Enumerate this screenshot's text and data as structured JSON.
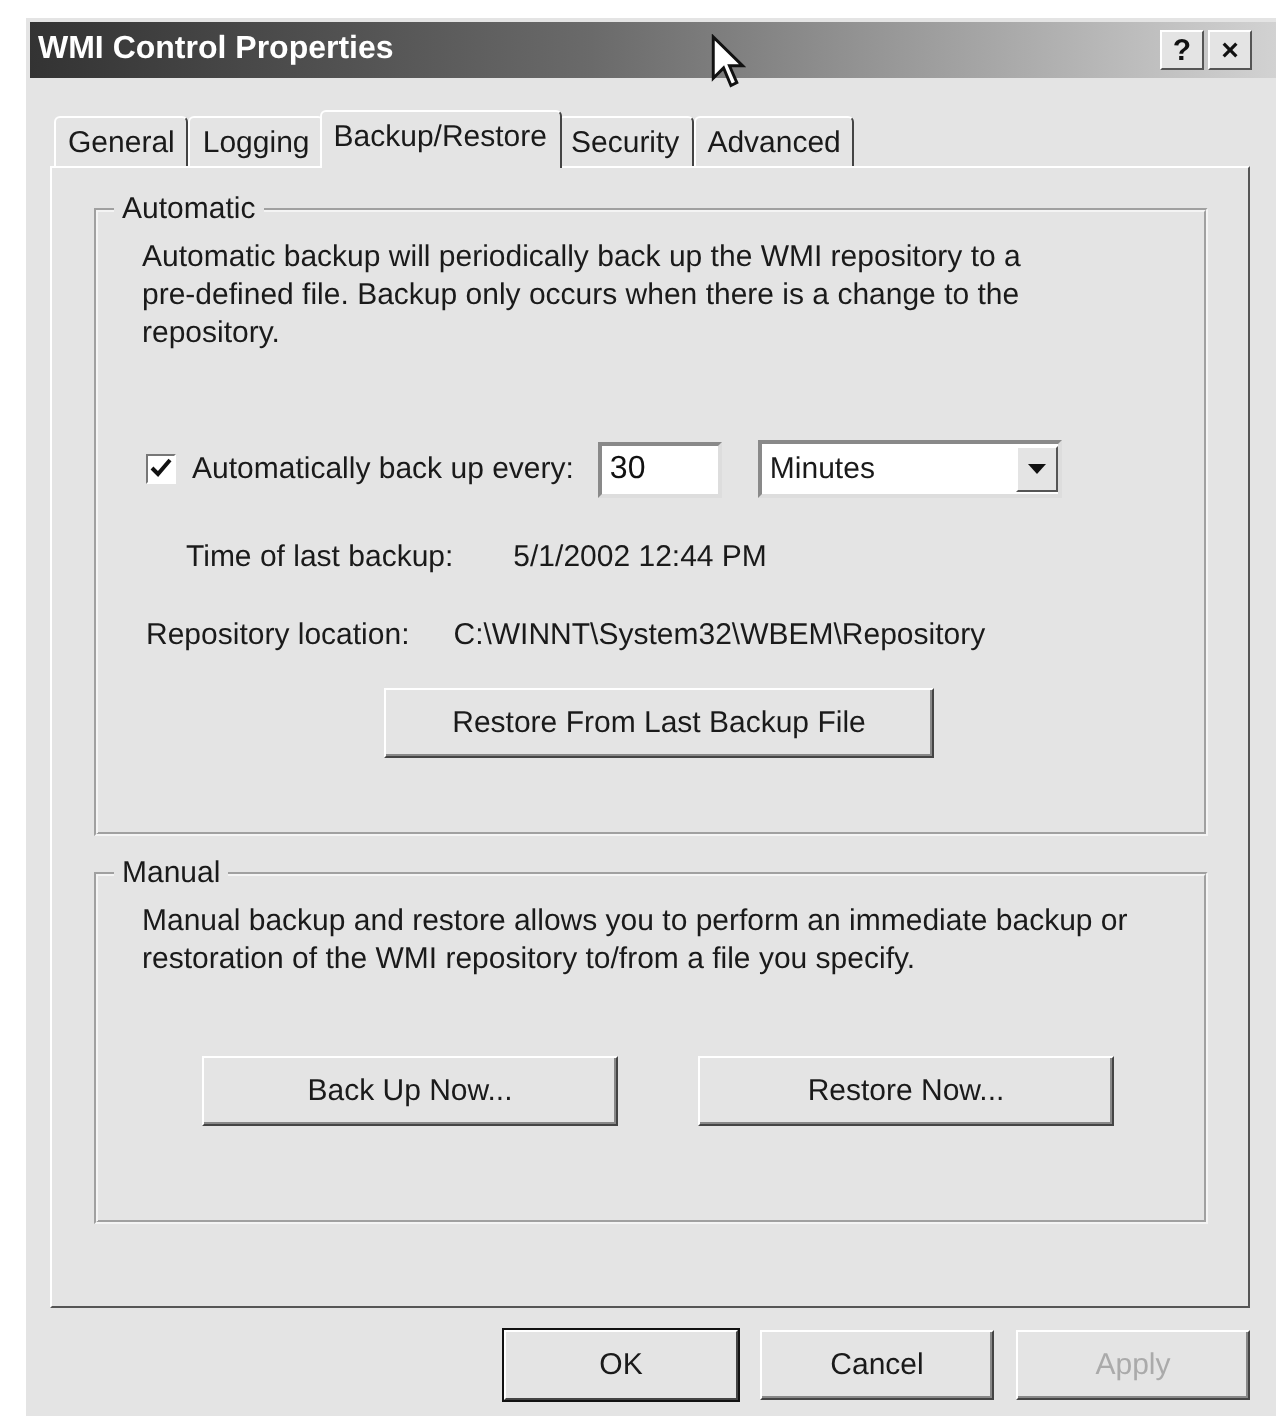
{
  "window": {
    "title": "WMI Control Properties",
    "caption_buttons": [
      "?",
      "×"
    ]
  },
  "tabs": [
    {
      "label": "General",
      "selected": false
    },
    {
      "label": "Logging",
      "selected": false
    },
    {
      "label": "Backup/Restore",
      "selected": true
    },
    {
      "label": "Security",
      "selected": false
    },
    {
      "label": "Advanced",
      "selected": false
    }
  ],
  "automatic": {
    "title": "Automatic",
    "description": "Automatic backup will periodically back up the WMI repository to a pre-defined file. Backup only occurs when there is a change to the repository.",
    "auto_backup": {
      "label": "Automatically back up every:",
      "checked": true,
      "interval": "30",
      "unit": "Minutes"
    },
    "last_backup": {
      "label": "Time of last backup:",
      "value": "5/1/2002 12:44 PM"
    },
    "repository": {
      "label": "Repository location:",
      "value": "C:\\WINNT\\System32\\WBEM\\Repository"
    },
    "restore_button": "Restore From Last Backup File"
  },
  "manual": {
    "title": "Manual",
    "description": "Manual backup and restore allows you to perform an immediate backup or restoration of the WMI repository to/from a file you specify.",
    "buttons": [
      "Back Up Now...",
      "Restore Now..."
    ]
  },
  "footer_buttons": [
    {
      "label": "OK",
      "default": true,
      "disabled": false
    },
    {
      "label": "Cancel",
      "default": false,
      "disabled": false
    },
    {
      "label": "Apply",
      "default": false,
      "disabled": true
    }
  ]
}
